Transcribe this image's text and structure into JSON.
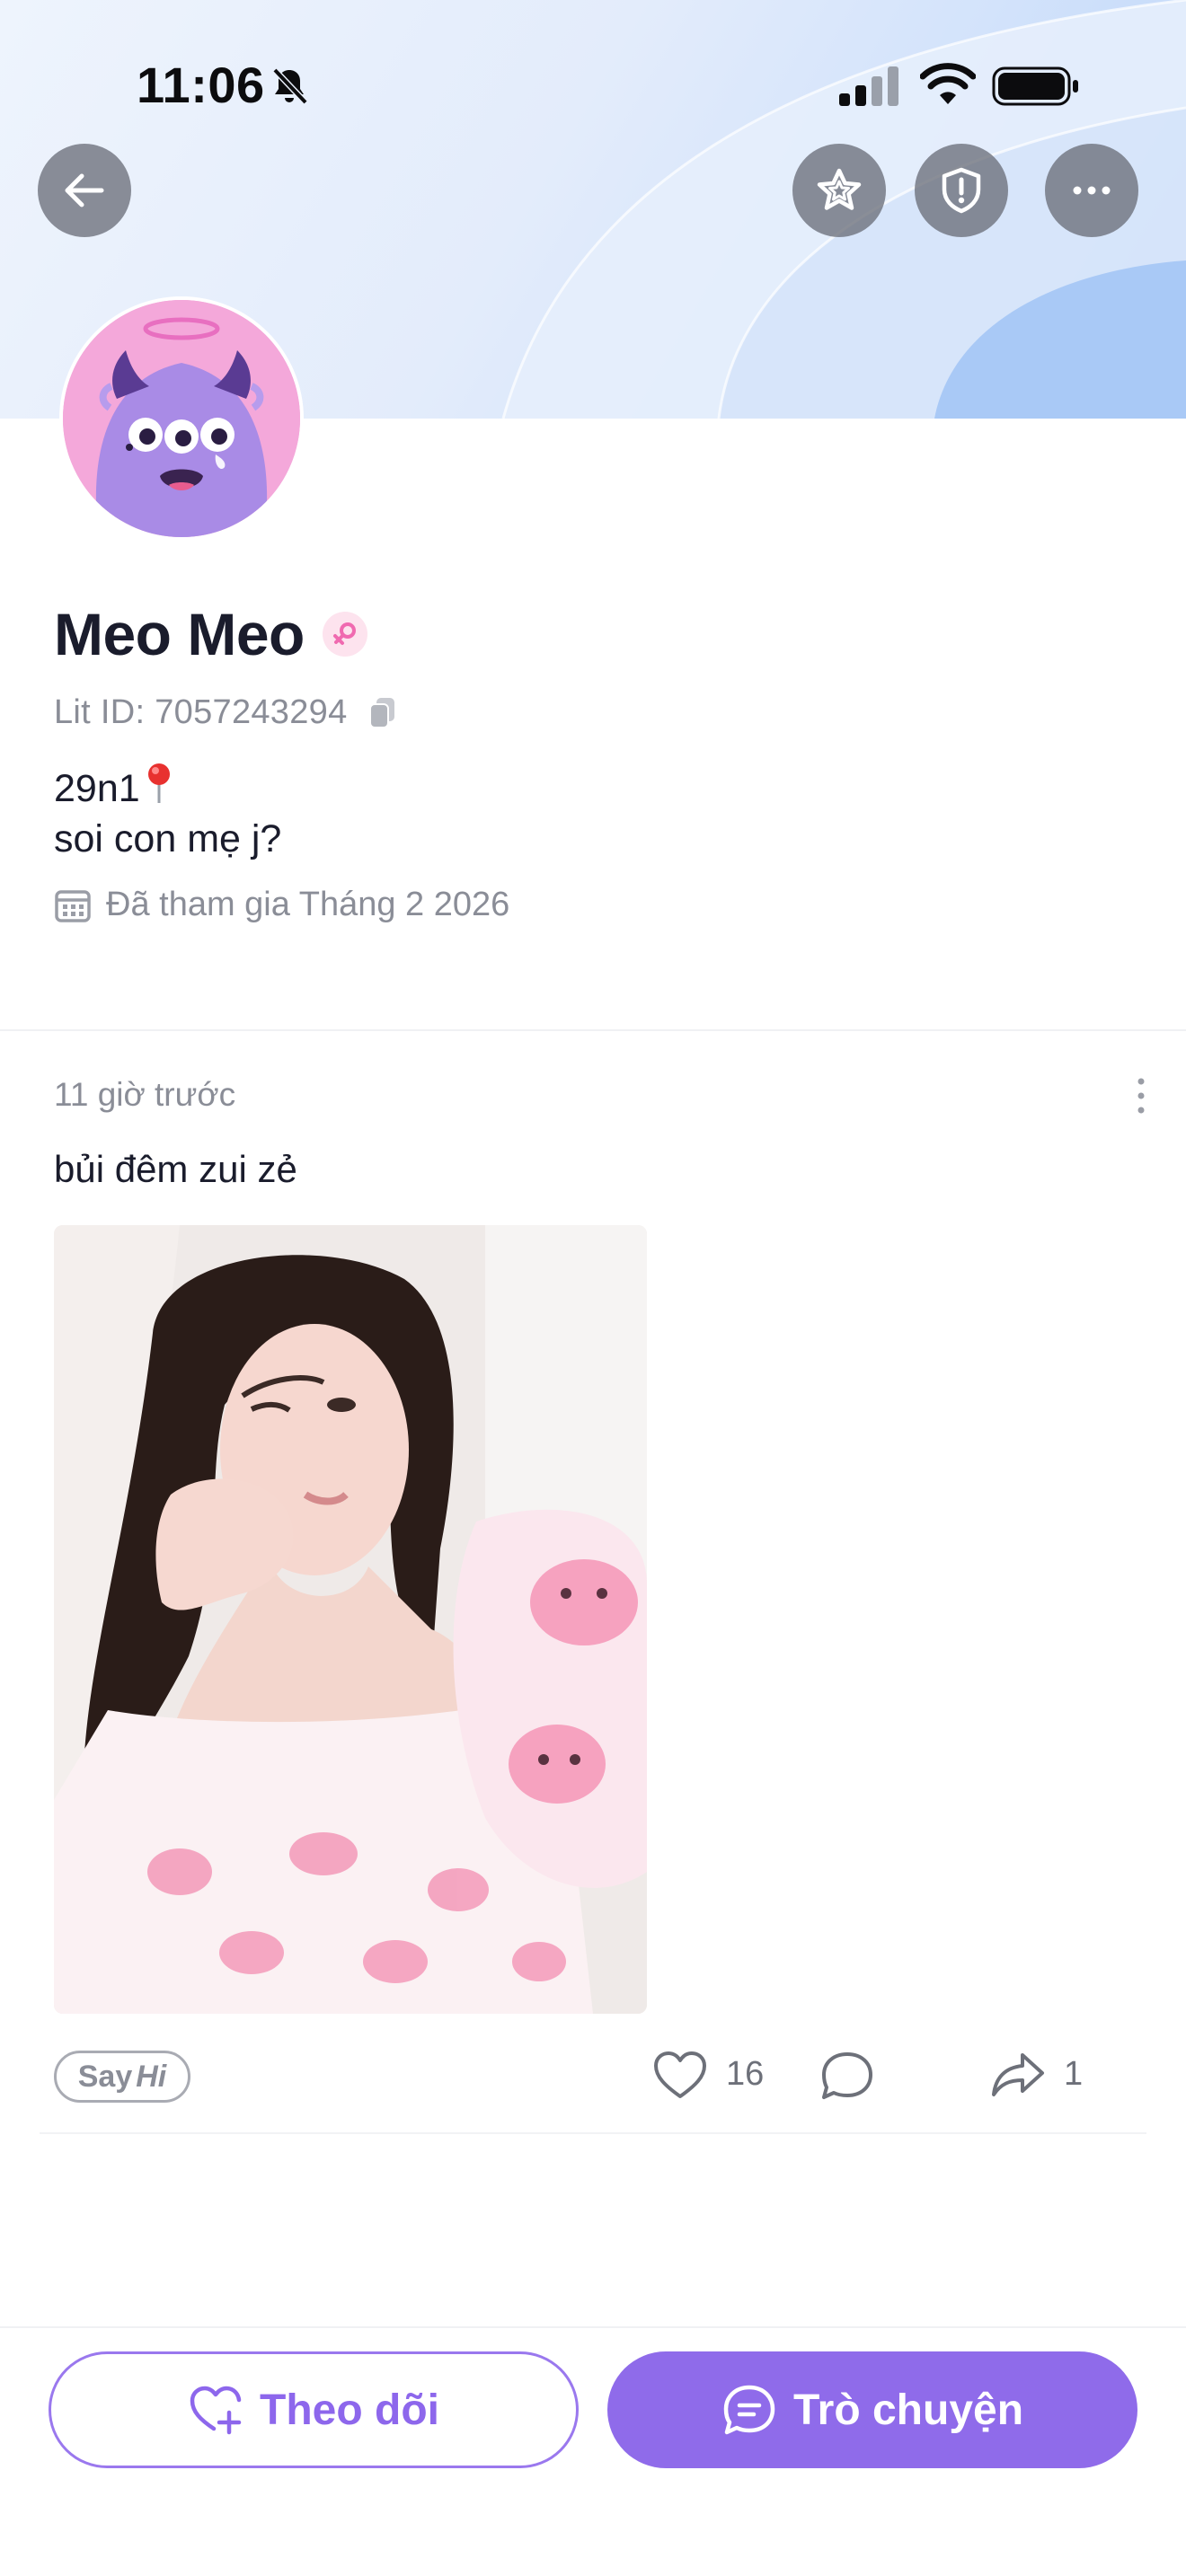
{
  "status_bar": {
    "time": "11:06",
    "icons": [
      "bell-off-icon",
      "cellular-signal-icon",
      "wifi-icon",
      "battery-icon"
    ]
  },
  "header": {
    "buttons": [
      "back-arrow-icon",
      "star-icon",
      "shield-alert-icon",
      "more-horizontal-icon"
    ]
  },
  "profile": {
    "name": "Meo Meo",
    "gender_icon": "female-symbol-icon",
    "lit_id": "Lit ID: 7057243294",
    "bio_line1": "29n1",
    "bio_line2": "soi con mẹ j?",
    "joined": "Đã tham gia Tháng 2 2026"
  },
  "post": {
    "time": "11 giờ trước",
    "text": "bủi đêm zui zẻ",
    "sayhi_say": "Say",
    "sayhi_hi": "Hi",
    "like_count": "16",
    "share_count": "1"
  },
  "actions": {
    "follow_label": "Theo dõi",
    "chat_label": "Trò chuyện"
  },
  "colors": {
    "accent": "#8f6bea",
    "text_primary": "#1a1c2c",
    "text_secondary": "#8a8d97"
  }
}
